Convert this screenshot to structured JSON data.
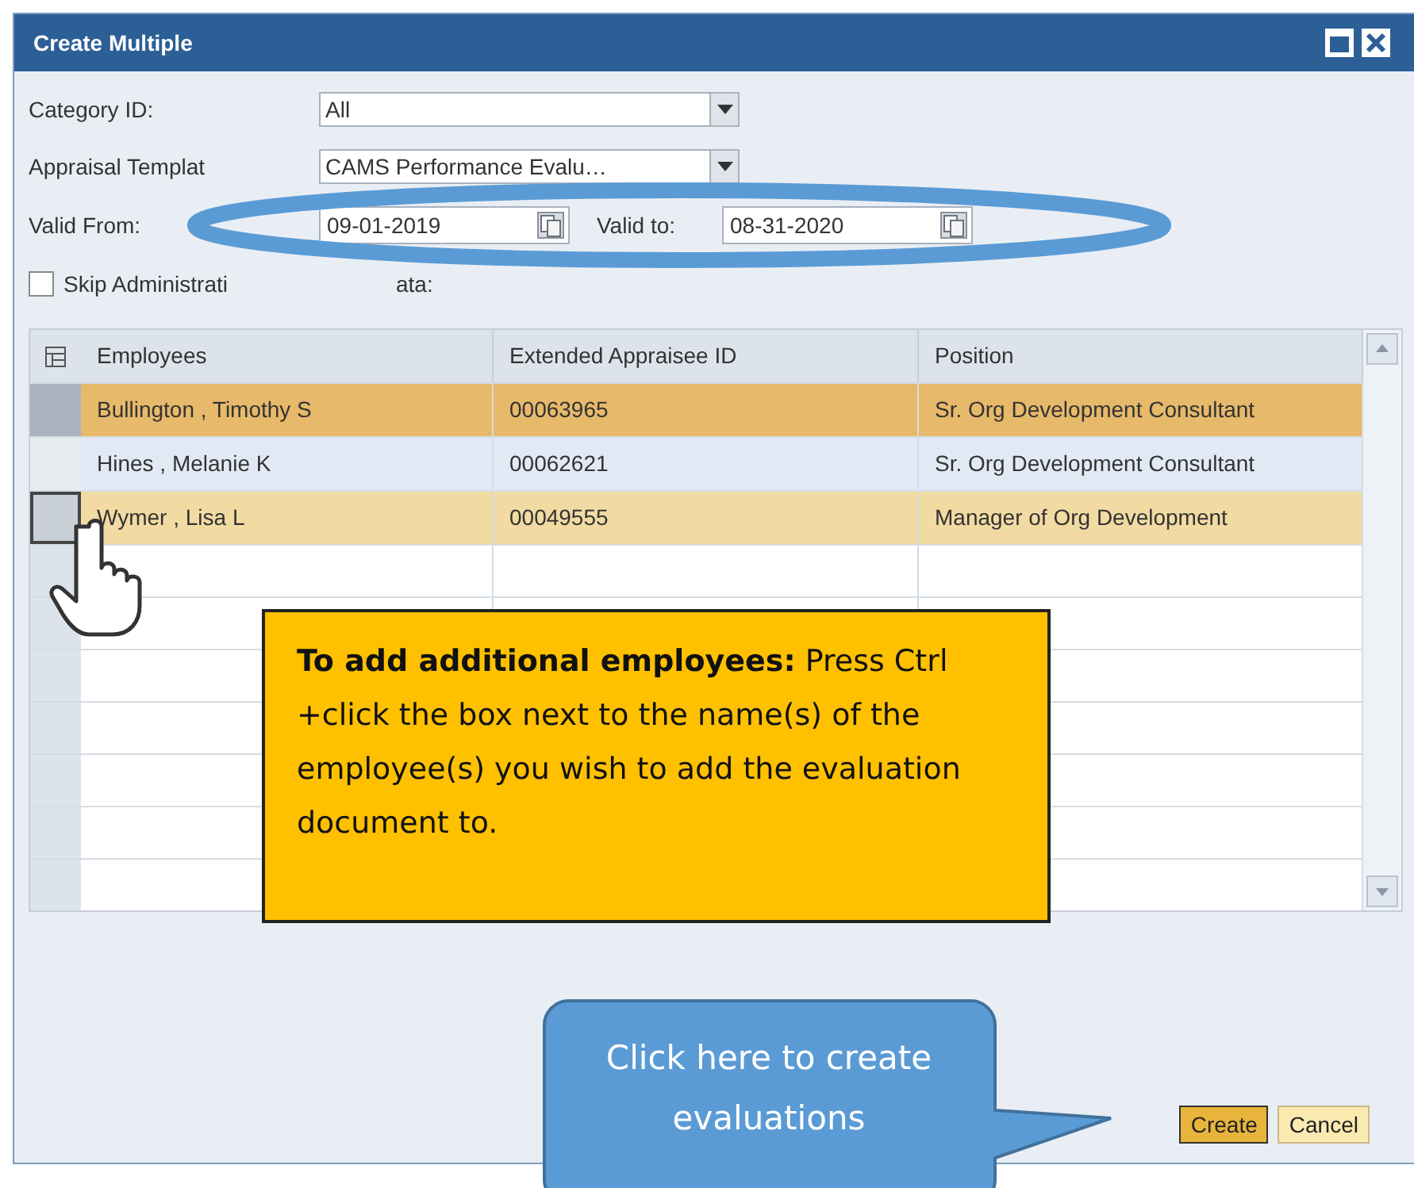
{
  "window": {
    "title": "Create Multiple"
  },
  "form": {
    "category": {
      "label": "Category ID:",
      "value": "All"
    },
    "template": {
      "label": "Appraisal Templat",
      "value": "CAMS Performance Evalu…"
    },
    "valid_from": {
      "label": "Valid From:",
      "value": "09-01-2019"
    },
    "valid_to": {
      "label": "Valid to:",
      "value": "08-31-2020"
    },
    "skip": {
      "label": "Skip Administrati",
      "tail": "ata:",
      "checked": false
    }
  },
  "table": {
    "columns": [
      "Employees",
      "Extended Appraisee ID",
      "Position"
    ],
    "rows": [
      {
        "cells": [
          "Bullington , Timothy S",
          "00063965",
          "Sr. Org Development Consultant"
        ],
        "selected": true,
        "hovered": false
      },
      {
        "cells": [
          "Hines , Melanie K",
          "00062621",
          "Sr. Org Development Consultant"
        ],
        "selected": false,
        "hovered": false
      },
      {
        "cells": [
          "Wymer , Lisa L",
          "00049555",
          "Manager of Org Development"
        ],
        "selected": false,
        "hovered": true
      }
    ]
  },
  "buttons": [
    {
      "label": "Create",
      "kind": "primary"
    },
    {
      "label": "Cancel",
      "kind": "secondary"
    }
  ],
  "callouts": {
    "tip_bold": "To add additional employees:",
    "tip": "Press Ctrl +click the box next to the name(s) of the employee(s) you wish to add the evaluation document to.",
    "create_hint": "Click here to create evaluations"
  }
}
